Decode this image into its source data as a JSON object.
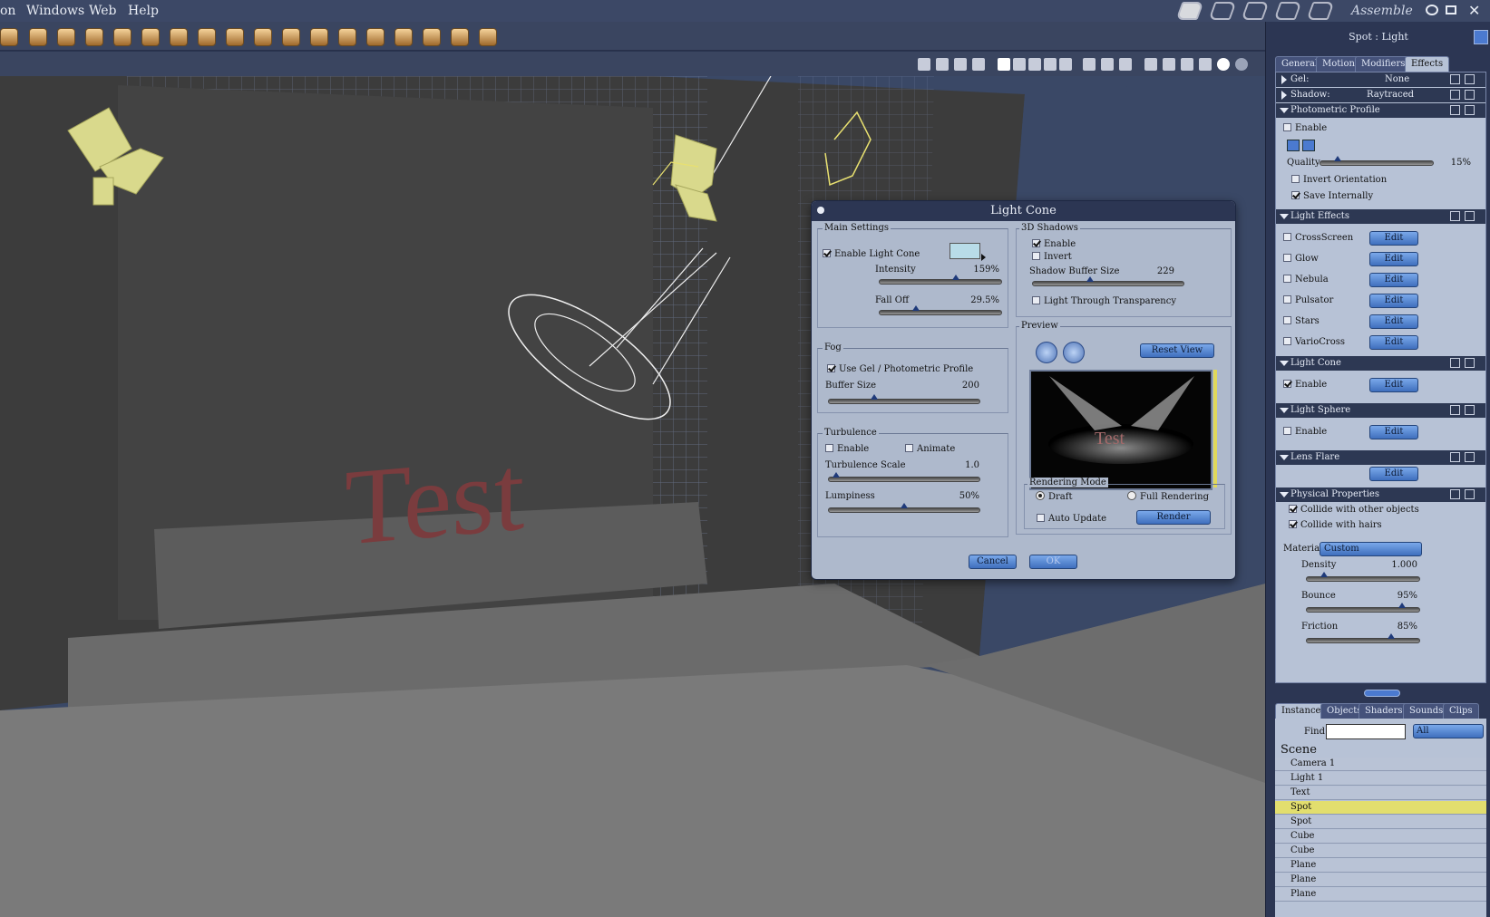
{
  "menu": {
    "items": [
      "on",
      "Windows",
      "Web",
      "Help"
    ],
    "room_label": "Assemble"
  },
  "viewport": {
    "text3d": "Test"
  },
  "dialog": {
    "title": "Light Cone",
    "main": {
      "title": "Main Settings",
      "enable_label": "Enable Light Cone",
      "enable": true,
      "intensity_label": "Intensity",
      "intensity_value": "159%",
      "intensity_level": 0.63,
      "falloff_label": "Fall Off",
      "falloff_value": "29.5%",
      "falloff_level": 0.3,
      "color": "#b8dce8"
    },
    "fog": {
      "title": "Fog",
      "usegel_label": "Use Gel / Photometric Profile",
      "usegel": true,
      "buffer_label": "Buffer Size",
      "buffer_value": "200",
      "buffer_level": 0.3
    },
    "turb": {
      "title": "Turbulence",
      "enable_label": "Enable",
      "animate_label": "Animate",
      "scale_label": "Turbulence Scale",
      "scale_value": "1.0",
      "scale_level": 0.05,
      "lump_label": "Lumpiness",
      "lump_value": "50%",
      "lump_level": 0.5
    },
    "shadows": {
      "title": "3D Shadows",
      "enable_label": "Enable",
      "enable": true,
      "invert_label": "Invert",
      "buffer_label": "Shadow Buffer Size",
      "buffer_value": "229",
      "buffer_level": 0.38,
      "through_label": "Light Through Transparency"
    },
    "preview": {
      "title": "Preview",
      "reset_label": "Reset View",
      "text": "Test"
    },
    "render": {
      "title": "Rendering Mode",
      "draft_label": "Draft",
      "full_label": "Full Rendering",
      "auto_label": "Auto Update",
      "render_label": "Render"
    },
    "cancel_label": "Cancel",
    "ok_label": "OK"
  },
  "panel": {
    "title": "Spot : Light",
    "tabs": [
      "General",
      "Motion",
      "Modifiers",
      "Effects"
    ],
    "gel": {
      "label": "Gel:",
      "value": "None"
    },
    "shadow": {
      "label": "Shadow:",
      "value": "Raytraced"
    },
    "photometric": {
      "title": "Photometric Profile",
      "enable_label": "Enable",
      "quality_label": "Quality",
      "quality_value": "15%",
      "quality_level": 0.15,
      "invert_label": "Invert Orientation",
      "save_label": "Save Internally"
    },
    "effects": {
      "title": "Light Effects",
      "items": [
        "CrossScreen",
        "Glow",
        "Nebula",
        "Pulsator",
        "Stars",
        "VarioCross"
      ],
      "edit_label": "Edit"
    },
    "cone": {
      "title": "Light Cone",
      "enable_label": "Enable",
      "edit_label": "Edit"
    },
    "sphere": {
      "title": "Light Sphere",
      "enable_label": "Enable",
      "edit_label": "Edit"
    },
    "flare": {
      "title": "Lens Flare",
      "edit_label": "Edit"
    },
    "physical": {
      "title": "Physical Properties",
      "collide_label": "Collide with other objects",
      "hairs_label": "Collide with hairs",
      "material_label": "Material",
      "material_value": "Custom",
      "density_label": "Density",
      "density_value": "1.000",
      "density_level": 0.15,
      "bounce_label": "Bounce",
      "bounce_value": "95%",
      "bounce_level": 0.85,
      "friction_label": "Friction",
      "friction_value": "85%",
      "friction_level": 0.75
    }
  },
  "browser": {
    "tabs": [
      "Instances",
      "Objects",
      "Shaders",
      "Sounds",
      "Clips"
    ],
    "find_label": "Find:",
    "find_value": "",
    "filter_value": "All",
    "scene_label": "Scene",
    "items": [
      "Camera 1",
      "Light 1",
      "Text",
      "Spot",
      "Spot",
      "Cube",
      "Cube",
      "Plane",
      "Plane",
      "Plane"
    ],
    "selected_index": 3
  }
}
